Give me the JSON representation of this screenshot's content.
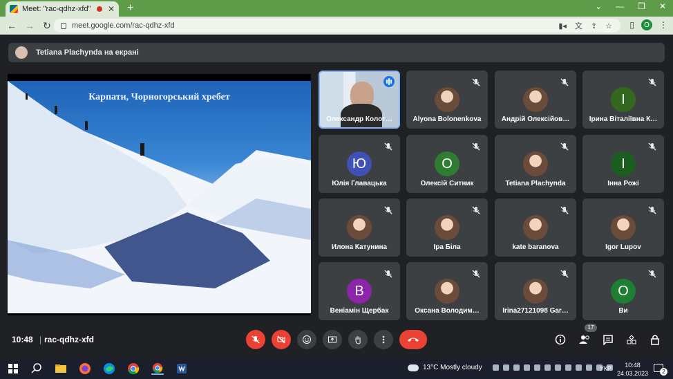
{
  "browser": {
    "tab_title": "Meet: \"rac-qdhz-xfd\"",
    "url": "meet.google.com/rac-qdhz-xfd",
    "profile_initial": "O"
  },
  "meet": {
    "presenting_banner": "Tetiana Plachynda на екрані",
    "slide_title": "Карпати, Чорногорський хребет",
    "time": "10:48",
    "meeting_code": "rac-qdhz-xfd",
    "participant_count": "17",
    "participants": [
      {
        "name": "Олександр Колот…",
        "initial": "",
        "color": "",
        "active": true
      },
      {
        "name": "Alyona Bolonenkova",
        "initial": "",
        "color": ""
      },
      {
        "name": "Андрій Олексійов…",
        "initial": "",
        "color": ""
      },
      {
        "name": "Ірина Віталіївна К…",
        "initial": "І",
        "color": "#33691e"
      },
      {
        "name": "Юлія Главацька",
        "initial": "Ю",
        "color": "#3f51b5"
      },
      {
        "name": "Олексій Ситник",
        "initial": "О",
        "color": "#2e7d32"
      },
      {
        "name": "Tetiana Plachynda",
        "initial": "",
        "color": ""
      },
      {
        "name": "Інна Рожі",
        "initial": "І",
        "color": "#1b5e20"
      },
      {
        "name": "Илона Катунина",
        "initial": "",
        "color": ""
      },
      {
        "name": "Іра Біла",
        "initial": "",
        "color": ""
      },
      {
        "name": "kate baranova",
        "initial": "",
        "color": ""
      },
      {
        "name": "Igor Lupov",
        "initial": "",
        "color": ""
      },
      {
        "name": "Веніамін Щербак",
        "initial": "В",
        "color": "#8e24aa"
      },
      {
        "name": "Оксана Володим…",
        "initial": "",
        "color": ""
      },
      {
        "name": "Irina27121098 Gar…",
        "initial": "",
        "color": ""
      },
      {
        "name": "Ви",
        "initial": "О",
        "color": "#1e7e34"
      }
    ]
  },
  "taskbar": {
    "weather": "13°C  Mostly cloudy",
    "language": "УКР",
    "clock_time": "10:48",
    "clock_date": "24.03.2023",
    "notifications": "2"
  }
}
